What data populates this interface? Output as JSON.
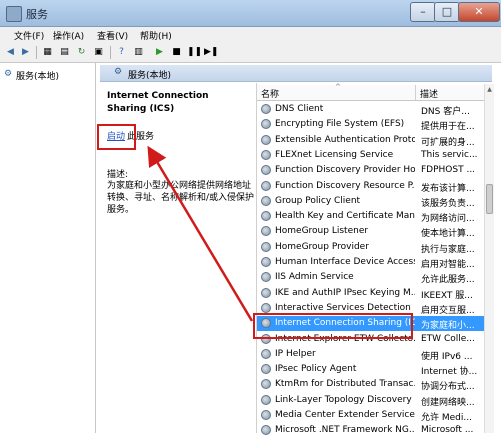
{
  "window": {
    "title": "服务"
  },
  "menu": [
    "文件(F)",
    "操作(A)",
    "查看(V)",
    "帮助(H)"
  ],
  "left_panel": {
    "node_label": "服务(本地)"
  },
  "right_header": {
    "label": "服务(本地)"
  },
  "detail": {
    "title": "Internet Connection Sharing (ICS)",
    "start_link": "启动",
    "start_suffix": "此服务",
    "description_label": "描述:",
    "description": "为家庭和小型办公网络提供网络地址转换、寻址、名称解析和/或入侵保护服务。"
  },
  "list": {
    "columns": {
      "name": "名称",
      "desc": "描述"
    },
    "rows": [
      {
        "name": "DNS Client",
        "desc": "DNS 客户..."
      },
      {
        "name": "Encrypting File System (EFS)",
        "desc": "提供用于在..."
      },
      {
        "name": "Extensible Authentication Proto...",
        "desc": "可扩展的身..."
      },
      {
        "name": "FLEXnet Licensing Service",
        "desc": "This servic..."
      },
      {
        "name": "Function Discovery Provider Host",
        "desc": "FDPHOST ..."
      },
      {
        "name": "Function Discovery Resource P...",
        "desc": "发布该计算..."
      },
      {
        "name": "Group Policy Client",
        "desc": "该服务负责..."
      },
      {
        "name": "Health Key and Certificate Man...",
        "desc": "为网络访问..."
      },
      {
        "name": "HomeGroup Listener",
        "desc": "使本地计算..."
      },
      {
        "name": "HomeGroup Provider",
        "desc": "执行与家庭..."
      },
      {
        "name": "Human Interface Device Access",
        "desc": "启用对智能..."
      },
      {
        "name": "IIS Admin Service",
        "desc": "允许此服务..."
      },
      {
        "name": "IKE and AuthIP IPsec Keying M...",
        "desc": "IKEEXT 服..."
      },
      {
        "name": "Interactive Services Detection",
        "desc": "启用交互服..."
      },
      {
        "name": "Internet Connection Sharing (IC...",
        "desc": "为家庭和小..."
      },
      {
        "name": "Internet Explorer ETW Collecto...",
        "desc": "ETW Colle..."
      },
      {
        "name": "IP Helper",
        "desc": "使用 IPv6 ..."
      },
      {
        "name": "IPsec Policy Agent",
        "desc": "Internet 协..."
      },
      {
        "name": "KtmRm for Distributed Transac...",
        "desc": "协调分布式..."
      },
      {
        "name": "Link-Layer Topology Discovery ...",
        "desc": "创建网络映..."
      },
      {
        "name": "Media Center Extender Service",
        "desc": "允许 Medi..."
      },
      {
        "name": "Microsoft .NET Framework NG...",
        "desc": "Microsoft ..."
      }
    ]
  }
}
